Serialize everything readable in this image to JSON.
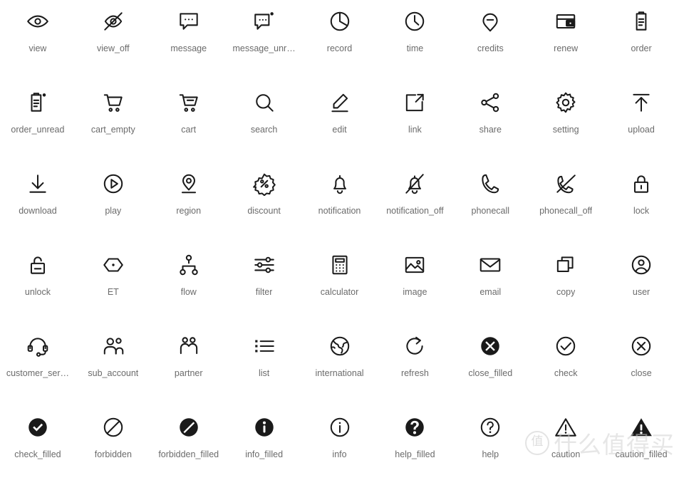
{
  "page": {
    "background_color": "#ffffff",
    "icon_color": "#1a1a1a",
    "label_color": "#6b6b6b",
    "columns": 9,
    "rows": 6
  },
  "watermark": {
    "badge": "值",
    "text": "什么值得买"
  },
  "icons": [
    {
      "name": "view",
      "label": "view",
      "glyph": "eye-icon"
    },
    {
      "name": "view_off",
      "label": "view_off",
      "glyph": "eye-off-icon"
    },
    {
      "name": "message",
      "label": "message",
      "glyph": "message-icon"
    },
    {
      "name": "message_unread",
      "label": "message_unr…",
      "glyph": "message-unread-icon"
    },
    {
      "name": "record",
      "label": "record",
      "glyph": "pie-chart-icon"
    },
    {
      "name": "time",
      "label": "time",
      "glyph": "clock-icon"
    },
    {
      "name": "credits",
      "label": "credits",
      "glyph": "credits-icon"
    },
    {
      "name": "renew",
      "label": "renew",
      "glyph": "wallet-icon"
    },
    {
      "name": "order",
      "label": "order",
      "glyph": "clipboard-icon"
    },
    {
      "name": "order_unread",
      "label": "order_unread",
      "glyph": "clipboard-unread-icon"
    },
    {
      "name": "cart_empty",
      "label": "cart_empty",
      "glyph": "cart-empty-icon"
    },
    {
      "name": "cart",
      "label": "cart",
      "glyph": "cart-icon"
    },
    {
      "name": "search",
      "label": "search",
      "glyph": "search-icon"
    },
    {
      "name": "edit",
      "label": "edit",
      "glyph": "edit-pencil-icon"
    },
    {
      "name": "link",
      "label": "link",
      "glyph": "external-link-icon"
    },
    {
      "name": "share",
      "label": "share",
      "glyph": "share-icon"
    },
    {
      "name": "setting",
      "label": "setting",
      "glyph": "gear-icon"
    },
    {
      "name": "upload",
      "label": "upload",
      "glyph": "upload-icon"
    },
    {
      "name": "download",
      "label": "download",
      "glyph": "download-icon"
    },
    {
      "name": "play",
      "label": "play",
      "glyph": "play-circle-icon"
    },
    {
      "name": "region",
      "label": "region",
      "glyph": "map-pin-icon"
    },
    {
      "name": "discount",
      "label": "discount",
      "glyph": "discount-burst-icon"
    },
    {
      "name": "notification",
      "label": "notification",
      "glyph": "bell-icon"
    },
    {
      "name": "notification_off",
      "label": "notification_off",
      "glyph": "bell-off-icon"
    },
    {
      "name": "phonecall",
      "label": "phonecall",
      "glyph": "phone-icon"
    },
    {
      "name": "phonecall_off",
      "label": "phonecall_off",
      "glyph": "phone-off-icon"
    },
    {
      "name": "lock",
      "label": "lock",
      "glyph": "lock-icon"
    },
    {
      "name": "unlock",
      "label": "unlock",
      "glyph": "unlock-icon"
    },
    {
      "name": "ET",
      "label": "ET",
      "glyph": "hexagon-dot-icon"
    },
    {
      "name": "flow",
      "label": "flow",
      "glyph": "flow-tree-icon"
    },
    {
      "name": "filter",
      "label": "filter",
      "glyph": "sliders-icon"
    },
    {
      "name": "calculator",
      "label": "calculator",
      "glyph": "calculator-icon"
    },
    {
      "name": "image",
      "label": "image",
      "glyph": "image-icon"
    },
    {
      "name": "email",
      "label": "email",
      "glyph": "envelope-icon"
    },
    {
      "name": "copy",
      "label": "copy",
      "glyph": "copy-icon"
    },
    {
      "name": "user",
      "label": "user",
      "glyph": "user-circle-icon"
    },
    {
      "name": "customer_service",
      "label": "customer_ser…",
      "glyph": "headset-icon"
    },
    {
      "name": "sub_account",
      "label": "sub_account",
      "glyph": "sub-account-icon"
    },
    {
      "name": "partner",
      "label": "partner",
      "glyph": "partner-icon"
    },
    {
      "name": "list",
      "label": "list",
      "glyph": "list-icon"
    },
    {
      "name": "international",
      "label": "international",
      "glyph": "globe-icon"
    },
    {
      "name": "refresh",
      "label": "refresh",
      "glyph": "refresh-icon"
    },
    {
      "name": "close_filled",
      "label": "close_filled",
      "glyph": "close-filled-icon"
    },
    {
      "name": "check",
      "label": "check",
      "glyph": "check-circle-icon"
    },
    {
      "name": "close",
      "label": "close",
      "glyph": "close-circle-icon"
    },
    {
      "name": "check_filled",
      "label": "check_filled",
      "glyph": "check-filled-icon"
    },
    {
      "name": "forbidden",
      "label": "forbidden",
      "glyph": "forbidden-icon"
    },
    {
      "name": "forbidden_filled",
      "label": "forbidden_filled",
      "glyph": "forbidden-filled-icon"
    },
    {
      "name": "info_filled",
      "label": "info_filled",
      "glyph": "info-filled-icon"
    },
    {
      "name": "info",
      "label": "info",
      "glyph": "info-circle-icon"
    },
    {
      "name": "help_filled",
      "label": "help_filled",
      "glyph": "help-filled-icon"
    },
    {
      "name": "help",
      "label": "help",
      "glyph": "help-circle-icon"
    },
    {
      "name": "caution",
      "label": "caution",
      "glyph": "caution-icon"
    },
    {
      "name": "caution_filled",
      "label": "caution_filled",
      "glyph": "caution-filled-icon"
    }
  ]
}
